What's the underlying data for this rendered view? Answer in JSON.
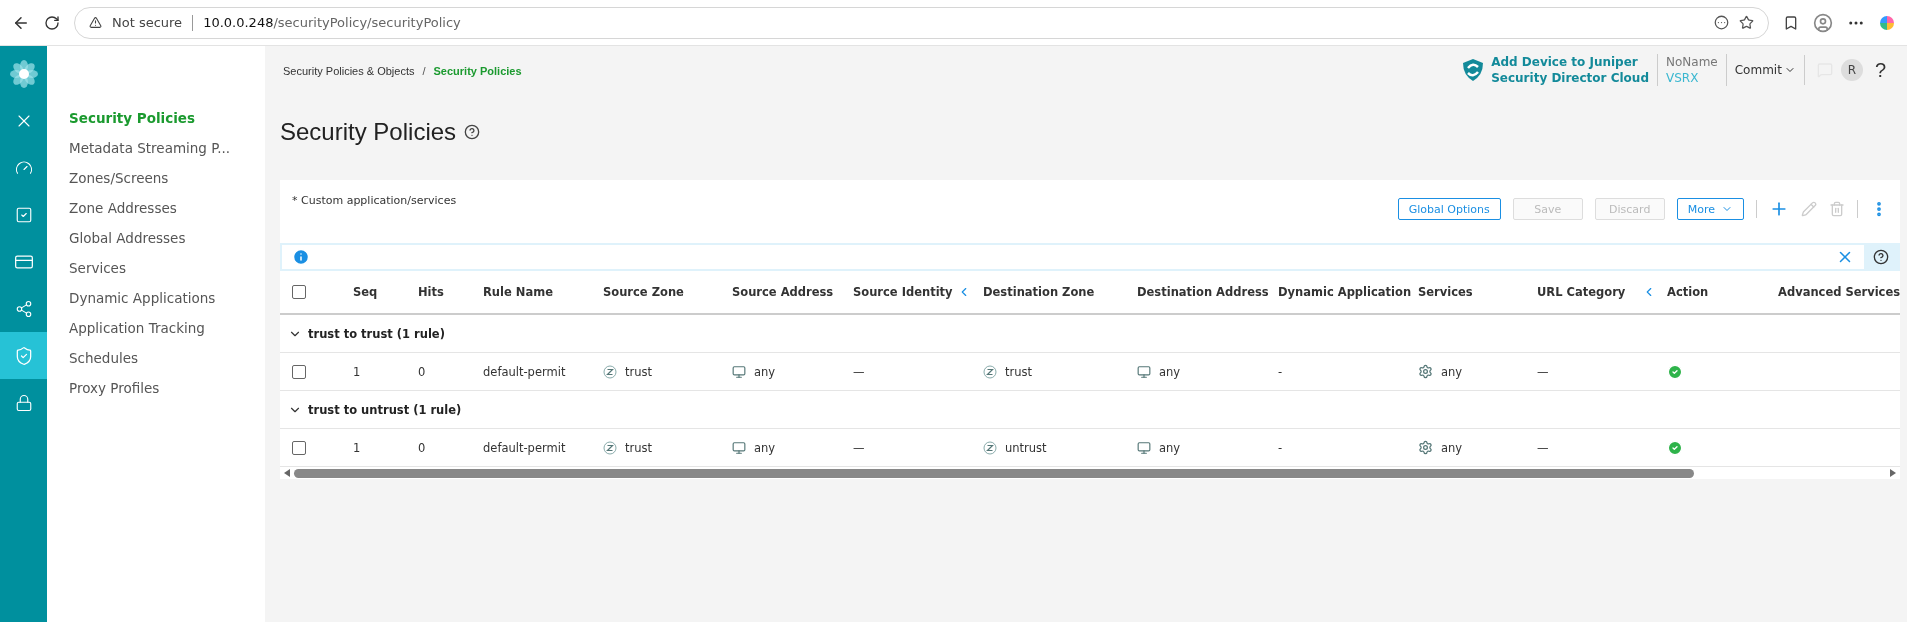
{
  "browser": {
    "security": "Not secure",
    "url_host": "10.0.0.248",
    "url_path": "/securityPolicy/securityPolicy"
  },
  "rail": [
    {
      "kind": "logo",
      "selected": false
    },
    {
      "kind": "close",
      "selected": false
    },
    {
      "kind": "dashboard",
      "selected": false
    },
    {
      "kind": "monitor",
      "selected": false
    },
    {
      "kind": "devices",
      "selected": false
    },
    {
      "kind": "network",
      "selected": false
    },
    {
      "kind": "security",
      "selected": true
    },
    {
      "kind": "lock",
      "selected": false
    }
  ],
  "sidebar": {
    "items": [
      {
        "label": "Security Policies",
        "selected": true
      },
      {
        "label": "Metadata Streaming P...",
        "selected": false
      },
      {
        "label": "Zones/Screens",
        "selected": false
      },
      {
        "label": "Zone Addresses",
        "selected": false
      },
      {
        "label": "Global Addresses",
        "selected": false
      },
      {
        "label": "Services",
        "selected": false
      },
      {
        "label": "Dynamic Applications",
        "selected": false
      },
      {
        "label": "Application Tracking",
        "selected": false
      },
      {
        "label": "Schedules",
        "selected": false
      },
      {
        "label": "Proxy Profiles",
        "selected": false
      }
    ]
  },
  "breadcrumb_separator": "/",
  "breadcrumb": [
    {
      "label": "Security Policies & Objects",
      "current": false
    },
    {
      "label": "Security Policies",
      "current": true
    }
  ],
  "header": {
    "device_link": [
      "Add Device to Juniper",
      "Security Director Cloud"
    ],
    "device_name": "NoName",
    "device_type": "VSRX",
    "commit": "Commit",
    "avatar": "R",
    "help": "?"
  },
  "title": "Security Policies",
  "note": "* Custom application/services",
  "toolbar": [
    {
      "label": "Global Options",
      "disabled": false,
      "kind": "button"
    },
    {
      "label": "Save",
      "disabled": true,
      "kind": "button"
    },
    {
      "label": "Discard",
      "disabled": true,
      "kind": "button"
    },
    {
      "label": "More",
      "disabled": false,
      "kind": "dropdown"
    }
  ],
  "table": {
    "columns": [
      {
        "label": "Seq",
        "chevron": false
      },
      {
        "label": "Hits",
        "chevron": false
      },
      {
        "label": "Rule Name",
        "chevron": false
      },
      {
        "label": "Source Zone",
        "chevron": false
      },
      {
        "label": "Source Address",
        "chevron": false
      },
      {
        "label": "Source Identity",
        "chevron": true
      },
      {
        "label": "Destination Zone",
        "chevron": false
      },
      {
        "label": "Destination Address",
        "chevron": false
      },
      {
        "label": "Dynamic Application",
        "chevron": false
      },
      {
        "label": "Services",
        "chevron": false
      },
      {
        "label": "URL Category",
        "chevron": true
      },
      {
        "label": "Action",
        "chevron": false
      },
      {
        "label": "Advanced Services",
        "chevron": false
      }
    ],
    "all_selected": false,
    "groups": [
      {
        "title": "trust to trust (1 rule)",
        "expanded": true,
        "rules": [
          {
            "selected": false,
            "seq": "1",
            "hits": "0",
            "rule_name": "default-permit",
            "source_zone": "trust",
            "source_address": "any",
            "source_identity": "—",
            "destination_zone": "trust",
            "destination_address": "any",
            "dynamic_application": "-",
            "services": "any",
            "url_category": "—",
            "permitted": true
          }
        ]
      },
      {
        "title": "trust to untrust (1 rule)",
        "expanded": true,
        "rules": [
          {
            "selected": false,
            "seq": "1",
            "hits": "0",
            "rule_name": "default-permit",
            "source_zone": "trust",
            "source_address": "any",
            "source_identity": "—",
            "destination_zone": "untrust",
            "destination_address": "any",
            "dynamic_application": "-",
            "services": "any",
            "url_category": "—",
            "permitted": true
          }
        ]
      }
    ]
  }
}
